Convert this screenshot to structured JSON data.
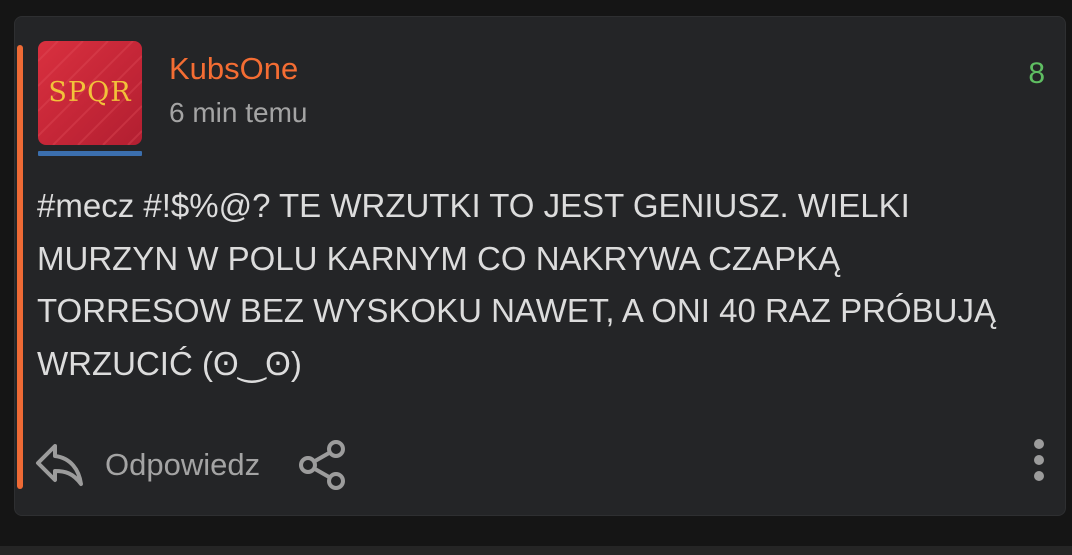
{
  "post": {
    "avatar_text": "SPQR",
    "author": "KubsOne",
    "time": "6 min temu",
    "votes": "8",
    "content": "#mecz #!$%@? TE WRZUTKI TO JEST GENIUSZ. WIELKI MURZYN W POLU KARNYM CO NAKRYWA CZAPKĄ TORRESOW BEZ WYSKOKU NAWET, A ONI 40 RAZ PRÓBUJĄ WRZUCIĆ (ʘ‿ʘ)"
  },
  "actions": {
    "reply_label": "Odpowiedz",
    "reply_icon": "reply-icon",
    "share_icon": "share-icon",
    "more_icon": "more-vertical-icon"
  },
  "colors": {
    "accent": "#ee6a35",
    "author": "#f46d33",
    "votes": "#5fbe62",
    "card_bg": "#242527",
    "page_bg": "#151515"
  }
}
